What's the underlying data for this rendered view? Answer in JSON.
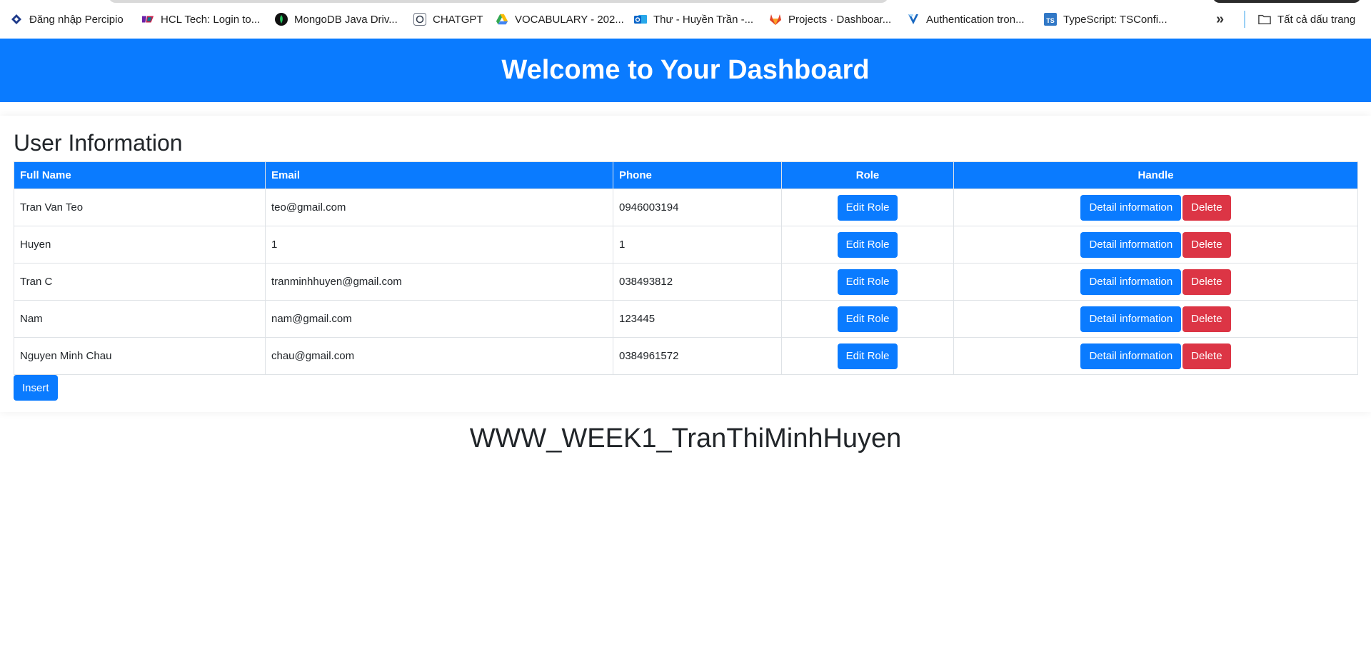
{
  "bookmarks": [
    {
      "label": "Đăng nhập Percipio",
      "icon": "percipio-icon"
    },
    {
      "label": "HCL Tech: Login to...",
      "icon": "hcl-icon"
    },
    {
      "label": "MongoDB Java Driv...",
      "icon": "mongodb-icon"
    },
    {
      "label": "CHATGPT",
      "icon": "chatgpt-icon"
    },
    {
      "label": "VOCABULARY - 202...",
      "icon": "google-drive-icon"
    },
    {
      "label": "Thư - Huyền Trần -...",
      "icon": "outlook-icon"
    },
    {
      "label": "Projects · Dashboar...",
      "icon": "gitlab-icon"
    },
    {
      "label": "Authentication tron...",
      "icon": "vuetify-icon"
    },
    {
      "label": "TypeScript: TSConfi...",
      "icon": "typescript-icon"
    }
  ],
  "bookmarks_more": "»",
  "all_bookmarks": "Tất cả dấu trang",
  "header": {
    "title": "Welcome to Your Dashboard"
  },
  "section": {
    "title": "User Information"
  },
  "table": {
    "columns": [
      "Full Name",
      "Email",
      "Phone",
      "Role",
      "Handle"
    ],
    "rows": [
      {
        "name": "Tran Van Teo",
        "email": "teo@gmail.com",
        "phone": "0946003194"
      },
      {
        "name": "Huyen",
        "email": "1",
        "phone": "1"
      },
      {
        "name": "Tran C",
        "email": "tranminhhuyen@gmail.com",
        "phone": "038493812"
      },
      {
        "name": "Nam",
        "email": "nam@gmail.com",
        "phone": "123445"
      },
      {
        "name": "Nguyen Minh Chau",
        "email": "chau@gmail.com",
        "phone": "0384961572"
      }
    ]
  },
  "buttons": {
    "edit_role": "Edit Role",
    "detail": "Detail information",
    "delete": "Delete",
    "insert": "Insert"
  },
  "footer": {
    "title": "WWW_WEEK1_TranThiMinhHuyen"
  },
  "colors": {
    "primary": "#0a7bff",
    "danger": "#dc3545",
    "text": "#212529"
  }
}
